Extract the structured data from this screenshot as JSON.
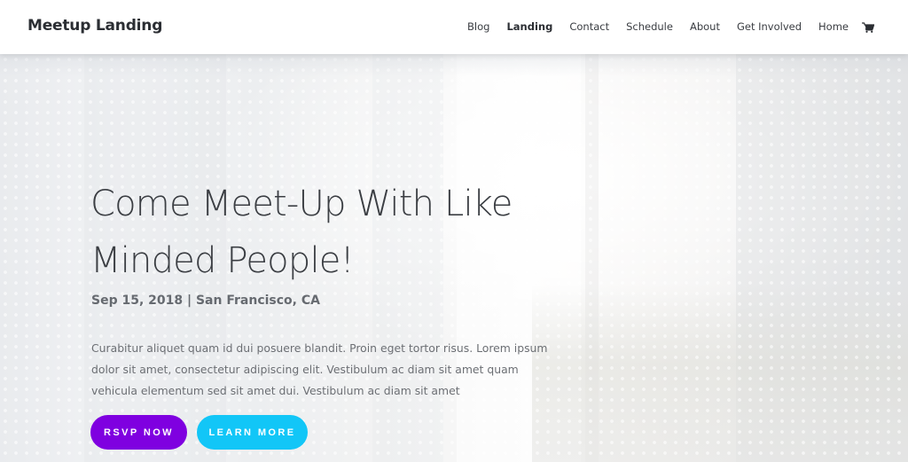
{
  "header": {
    "logo": "Meetup Landing",
    "nav": [
      {
        "label": "Blog",
        "active": false
      },
      {
        "label": "Landing",
        "active": true
      },
      {
        "label": "Contact",
        "active": false
      },
      {
        "label": "Schedule",
        "active": false
      },
      {
        "label": "About",
        "active": false
      },
      {
        "label": "Get Involved",
        "active": false
      },
      {
        "label": "Home",
        "active": false
      }
    ],
    "cart_icon": "shopping-cart-icon"
  },
  "hero": {
    "title": "Come Meet-Up With Like Minded People!",
    "subtitle": "Sep 15, 2018 | San Francisco, CA",
    "description": "Curabitur aliquet quam id dui posuere blandit. Proin eget tortor risus. Lorem ipsum dolor sit amet, consectetur adipiscing elit. Vestibulum ac diam sit amet quam vehicula elementum sed sit amet dui. Vestibulum ac diam sit amet",
    "buttons": {
      "rsvp": "RSVP NOW",
      "learn_more": "LEARN MORE"
    }
  },
  "colors": {
    "primary_purple": "#7f00e0",
    "accent_cyan": "#12c6f7",
    "heading_text": "#3b3e43",
    "body_text": "#6c6f74"
  }
}
